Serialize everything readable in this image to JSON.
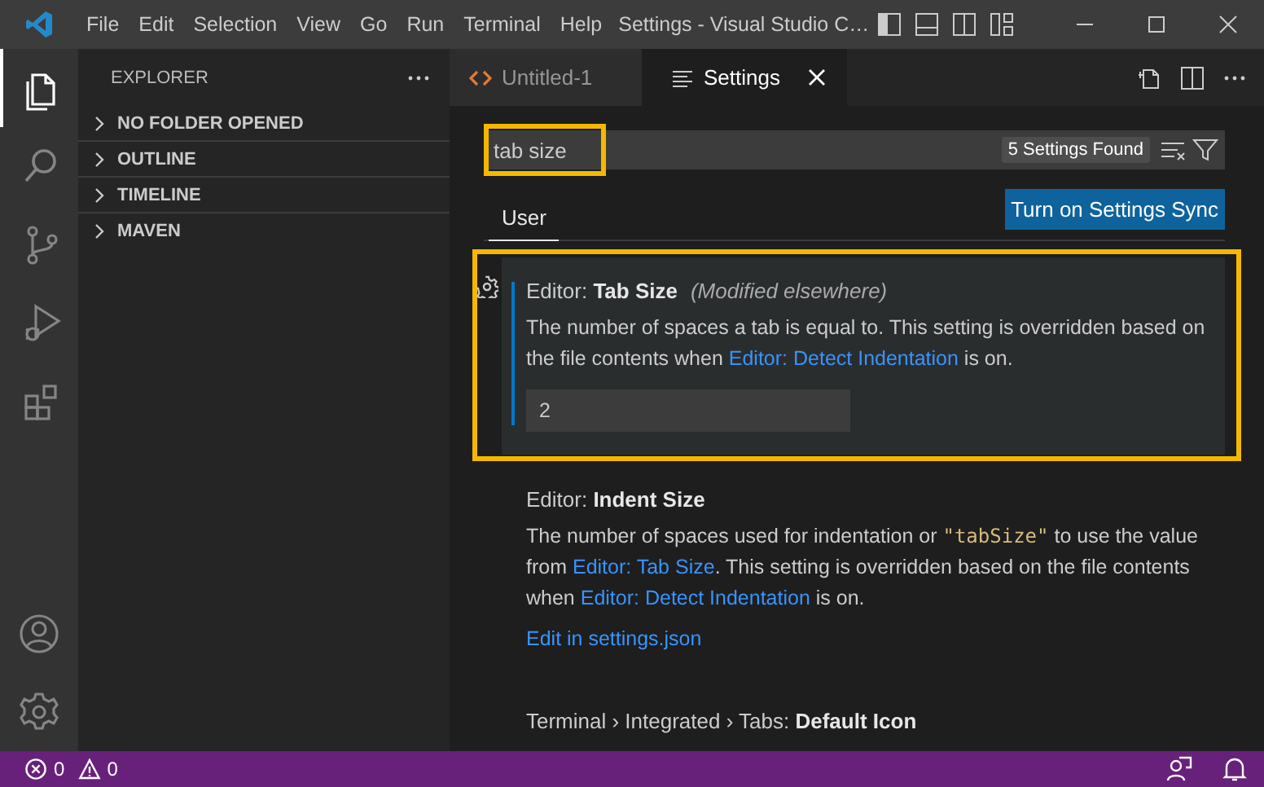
{
  "title_bar": {
    "menu": [
      "File",
      "Edit",
      "Selection",
      "View",
      "Go",
      "Run",
      "Terminal",
      "Help"
    ],
    "title": "Settings - Visual Studio C…"
  },
  "activity_bar": {
    "items": [
      {
        "kind": "explorer",
        "selected": true
      },
      {
        "kind": "search",
        "selected": false
      },
      {
        "kind": "source-control",
        "selected": false
      },
      {
        "kind": "run",
        "selected": false
      },
      {
        "kind": "extensions",
        "selected": false
      }
    ]
  },
  "sidebar": {
    "title": "EXPLORER",
    "sections": [
      {
        "label": "NO FOLDER OPENED",
        "expanded": false
      },
      {
        "label": "OUTLINE",
        "expanded": false
      },
      {
        "label": "TIMELINE",
        "expanded": false
      },
      {
        "label": "MAVEN",
        "expanded": false
      }
    ]
  },
  "tabs": [
    {
      "label": "Untitled-1",
      "kind": "code",
      "selected": false
    },
    {
      "label": "Settings",
      "kind": "settings",
      "selected": true
    }
  ],
  "settings_editor": {
    "search": {
      "value": "tab size",
      "highlighted": true
    },
    "result_count": "5 Settings Found",
    "scopes": [
      {
        "label": "User",
        "selected": true
      }
    ],
    "sync_button": "Turn on Settings Sync",
    "settings": [
      {
        "title": "Editor: **Tab Size**",
        "modified": "(Modified elsewhere)",
        "focused": true,
        "highlighted": true,
        "description": [
          {
            "kind": "text",
            "text": "The number of spaces a tab is equal to. This setting is overridden based on the file contents when "
          },
          {
            "kind": "link",
            "text": "Editor: Detect Indentation"
          },
          {
            "kind": "text",
            "text": " is on."
          }
        ],
        "value": "2"
      },
      {
        "title": "Editor: **Indent Size**",
        "focused": false,
        "highlighted": false,
        "description": [
          {
            "kind": "text",
            "text": "The number of spaces used for indentation or "
          },
          {
            "kind": "code",
            "text": "\"tabSize\""
          },
          {
            "kind": "text",
            "text": " to use the value from "
          },
          {
            "kind": "link",
            "text": "Editor: Tab Size"
          },
          {
            "kind": "text",
            "text": ". This setting is overridden based on the file contents when "
          },
          {
            "kind": "link",
            "text": "Editor: Detect Indentation"
          },
          {
            "kind": "text",
            "text": " is on."
          }
        ],
        "edit_link": "Edit in settings.json"
      },
      {
        "title": "Terminal › Integrated › Tabs: **Default Icon**",
        "focused": false,
        "highlighted": false
      }
    ]
  },
  "status_bar": {
    "errors": "0",
    "warnings": "0"
  }
}
